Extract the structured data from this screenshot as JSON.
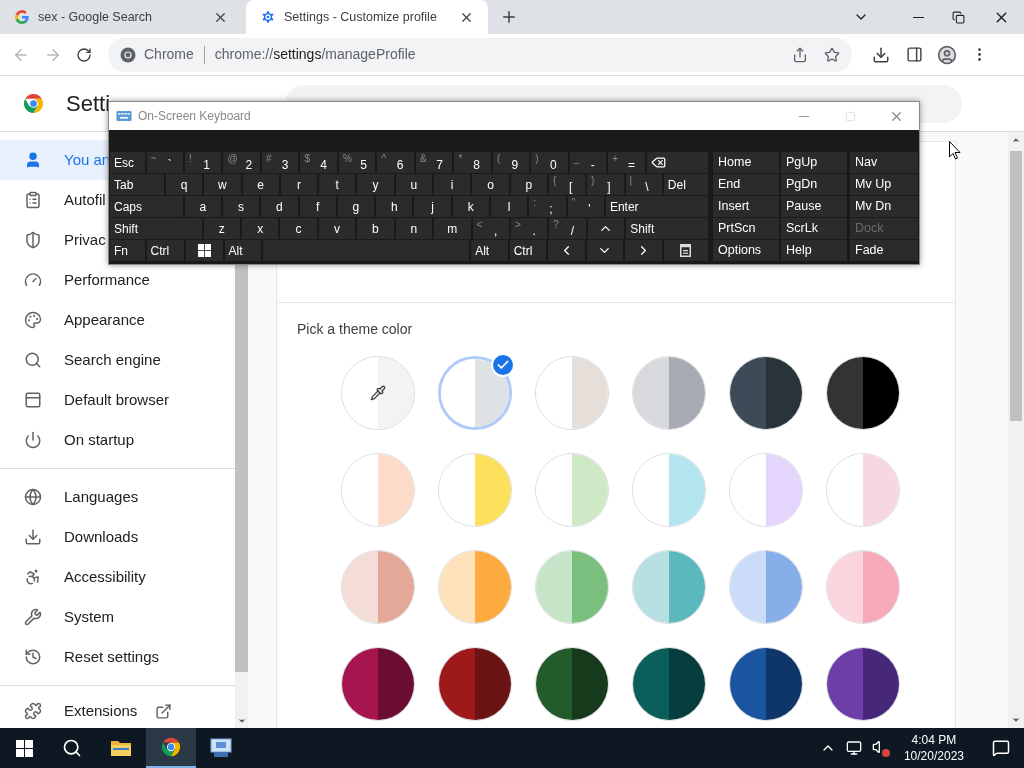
{
  "browser": {
    "tabs": [
      {
        "title": "sex - Google Search",
        "kind": "search",
        "selected": false
      },
      {
        "title": "Settings - Customize profile",
        "kind": "settings",
        "selected": true
      }
    ],
    "omnibox": {
      "chip": "Chrome",
      "url": {
        "scheme": "chrome://",
        "host": "settings",
        "path": "/manageProfile"
      }
    }
  },
  "settings": {
    "title": "Setti",
    "sidebar": {
      "groups": [
        [
          {
            "label": "You an",
            "selected": true
          },
          {
            "label": "Autofil",
            "selected": false
          },
          {
            "label": "Privac",
            "selected": false
          },
          {
            "label": "Performance",
            "selected": false
          },
          {
            "label": "Appearance",
            "selected": false
          },
          {
            "label": "Search engine",
            "selected": false
          },
          {
            "label": "Default browser",
            "selected": false
          },
          {
            "label": "On startup",
            "selected": false
          }
        ],
        [
          {
            "label": "Languages",
            "selected": false
          },
          {
            "label": "Downloads",
            "selected": false
          },
          {
            "label": "Accessibility",
            "selected": false
          },
          {
            "label": "System",
            "selected": false
          },
          {
            "label": "Reset settings",
            "selected": false
          }
        ],
        [
          {
            "label": "Extensions",
            "selected": false
          }
        ]
      ]
    }
  },
  "theme": {
    "heading": "Pick a theme color",
    "swatches": [
      {
        "kind": "custom",
        "halves": [
          {
            "color": "#ffffff"
          },
          {
            "color": "#f1f3f4"
          }
        ],
        "selected": false
      },
      {
        "kind": "preset",
        "halves": [
          {
            "color": "#ffffff"
          },
          {
            "color": "#dee1e6"
          }
        ],
        "selected": true
      },
      {
        "kind": "preset",
        "halves": [
          {
            "color": "#ffffff"
          },
          {
            "color": "#e6dfd9"
          }
        ],
        "selected": false
      },
      {
        "kind": "preset",
        "halves": [
          {
            "color": "#d7d9dd"
          },
          {
            "color": "#a8abb3"
          }
        ],
        "selected": false
      },
      {
        "kind": "preset",
        "halves": [
          {
            "color": "#3c4b57"
          },
          {
            "color": "#28333a"
          }
        ],
        "selected": false
      },
      {
        "kind": "preset",
        "halves": [
          {
            "color": "#333333"
          },
          {
            "color": "#000000"
          }
        ],
        "selected": false
      },
      {
        "kind": "preset",
        "halves": [
          {
            "color": "#ffffff"
          },
          {
            "color": "#fcdbc8"
          }
        ],
        "selected": false
      },
      {
        "kind": "preset",
        "halves": [
          {
            "color": "#ffffff"
          },
          {
            "color": "#fde05c"
          }
        ],
        "selected": false
      },
      {
        "kind": "preset",
        "halves": [
          {
            "color": "#ffffff"
          },
          {
            "color": "#cfe8c6"
          }
        ],
        "selected": false
      },
      {
        "kind": "preset",
        "halves": [
          {
            "color": "#ffffff"
          },
          {
            "color": "#b3e5ef"
          }
        ],
        "selected": false
      },
      {
        "kind": "preset",
        "halves": [
          {
            "color": "#ffffff"
          },
          {
            "color": "#e3d5fb"
          }
        ],
        "selected": false
      },
      {
        "kind": "preset",
        "halves": [
          {
            "color": "#ffffff"
          },
          {
            "color": "#f7d7e3"
          }
        ],
        "selected": false
      },
      {
        "kind": "preset",
        "halves": [
          {
            "color": "#f3ddd6"
          },
          {
            "color": "#e3a897"
          }
        ],
        "selected": false
      },
      {
        "kind": "preset",
        "halves": [
          {
            "color": "#fde2bb"
          },
          {
            "color": "#fdab41"
          }
        ],
        "selected": false
      },
      {
        "kind": "preset",
        "halves": [
          {
            "color": "#c6e5c8"
          },
          {
            "color": "#7abf7e"
          }
        ],
        "selected": false
      },
      {
        "kind": "preset",
        "halves": [
          {
            "color": "#b6e0e2"
          },
          {
            "color": "#5bb9be"
          }
        ],
        "selected": false
      },
      {
        "kind": "preset",
        "halves": [
          {
            "color": "#cbdcf8"
          },
          {
            "color": "#86aee9"
          }
        ],
        "selected": false
      },
      {
        "kind": "preset",
        "halves": [
          {
            "color": "#fad5dd"
          },
          {
            "color": "#f6a9b8"
          }
        ],
        "selected": false
      },
      {
        "kind": "preset",
        "halves": [
          {
            "color": "#a6154e"
          },
          {
            "color": "#6b0d32"
          }
        ],
        "selected": false
      },
      {
        "kind": "preset",
        "halves": [
          {
            "color": "#9e1a1a"
          },
          {
            "color": "#6a1414"
          }
        ],
        "selected": false
      },
      {
        "kind": "preset",
        "halves": [
          {
            "color": "#245b2a"
          },
          {
            "color": "#173a1c"
          }
        ],
        "selected": false
      },
      {
        "kind": "preset",
        "halves": [
          {
            "color": "#0a5e5c"
          },
          {
            "color": "#063e3d"
          }
        ],
        "selected": false
      },
      {
        "kind": "preset",
        "halves": [
          {
            "color": "#1a56a0"
          },
          {
            "color": "#0f3669"
          }
        ],
        "selected": false
      },
      {
        "kind": "preset",
        "halves": [
          {
            "color": "#6b3ea8"
          },
          {
            "color": "#46277a"
          }
        ],
        "selected": false
      }
    ]
  },
  "keyboard": {
    "title": "On-Screen Keyboard",
    "rows": [
      [
        {
          "kind": "word",
          "label": "Esc"
        },
        {
          "kind": "shifted",
          "shift": "~",
          "label": "`"
        },
        {
          "kind": "shifted",
          "shift": "!",
          "label": "1"
        },
        {
          "kind": "shifted",
          "shift": "@",
          "label": "2"
        },
        {
          "kind": "shifted",
          "shift": "#",
          "label": "3"
        },
        {
          "kind": "shifted",
          "shift": "$",
          "label": "4"
        },
        {
          "kind": "shifted",
          "shift": "%",
          "label": "5"
        },
        {
          "kind": "shifted",
          "shift": "^",
          "label": "6"
        },
        {
          "kind": "shifted",
          "shift": "&",
          "label": "7"
        },
        {
          "kind": "shifted",
          "shift": "*",
          "label": "8"
        },
        {
          "kind": "shifted",
          "shift": "(",
          "label": "9"
        },
        {
          "kind": "shifted",
          "shift": ")",
          "label": "0"
        },
        {
          "kind": "shifted",
          "shift": "_",
          "label": "-"
        },
        {
          "kind": "shifted",
          "shift": "+",
          "label": "="
        },
        {
          "kind": "backspace"
        }
      ],
      [
        {
          "kind": "word",
          "label": "Tab"
        },
        {
          "kind": "char",
          "label": "q"
        },
        {
          "kind": "char",
          "label": "w"
        },
        {
          "kind": "char",
          "label": "e"
        },
        {
          "kind": "char",
          "label": "r"
        },
        {
          "kind": "char",
          "label": "t"
        },
        {
          "kind": "char",
          "label": "y"
        },
        {
          "kind": "char",
          "label": "u"
        },
        {
          "kind": "char",
          "label": "i"
        },
        {
          "kind": "char",
          "label": "o"
        },
        {
          "kind": "char",
          "label": "p"
        },
        {
          "kind": "shifted",
          "shift": "{",
          "label": "["
        },
        {
          "kind": "shifted",
          "shift": "}",
          "label": "]"
        },
        {
          "kind": "shifted",
          "shift": "|",
          "label": "\\"
        },
        {
          "kind": "word",
          "label": "Del"
        }
      ],
      [
        {
          "kind": "word",
          "label": "Caps"
        },
        {
          "kind": "char",
          "label": "a"
        },
        {
          "kind": "char",
          "label": "s"
        },
        {
          "kind": "char",
          "label": "d"
        },
        {
          "kind": "char",
          "label": "f"
        },
        {
          "kind": "char",
          "label": "g"
        },
        {
          "kind": "char",
          "label": "h"
        },
        {
          "kind": "char",
          "label": "j"
        },
        {
          "kind": "char",
          "label": "k"
        },
        {
          "kind": "char",
          "label": "l"
        },
        {
          "kind": "shifted",
          "shift": ":",
          "label": ";"
        },
        {
          "kind": "shifted",
          "shift": "\"",
          "label": "'"
        },
        {
          "kind": "word",
          "label": "Enter"
        }
      ],
      [
        {
          "kind": "word",
          "label": "Shift"
        },
        {
          "kind": "char",
          "label": "z"
        },
        {
          "kind": "char",
          "label": "x"
        },
        {
          "kind": "char",
          "label": "c"
        },
        {
          "kind": "char",
          "label": "v"
        },
        {
          "kind": "char",
          "label": "b"
        },
        {
          "kind": "char",
          "label": "n"
        },
        {
          "kind": "char",
          "label": "m"
        },
        {
          "kind": "shifted",
          "shift": "<",
          "label": ","
        },
        {
          "kind": "shifted",
          "shift": ">",
          "label": "."
        },
        {
          "kind": "shifted",
          "shift": "?",
          "label": "/"
        },
        {
          "kind": "up"
        },
        {
          "kind": "word",
          "label": "Shift"
        }
      ],
      [
        {
          "kind": "word",
          "label": "Fn"
        },
        {
          "kind": "word",
          "label": "Ctrl"
        },
        {
          "kind": "windows"
        },
        {
          "kind": "word",
          "label": "Alt"
        },
        {
          "kind": "space"
        },
        {
          "kind": "word",
          "label": "Alt"
        },
        {
          "kind": "word",
          "label": "Ctrl"
        },
        {
          "kind": "left"
        },
        {
          "kind": "down"
        },
        {
          "kind": "right"
        },
        {
          "kind": "menu"
        }
      ]
    ],
    "nav": [
      [
        {
          "label": "Home",
          "disabled": false
        },
        {
          "label": "PgUp",
          "disabled": false
        },
        {
          "label": "Nav",
          "disabled": false
        }
      ],
      [
        {
          "label": "End",
          "disabled": false
        },
        {
          "label": "PgDn",
          "disabled": false
        },
        {
          "label": "Mv Up",
          "disabled": false
        }
      ],
      [
        {
          "label": "Insert",
          "disabled": false
        },
        {
          "label": "Pause",
          "disabled": false
        },
        {
          "label": "Mv Dn",
          "disabled": false
        }
      ],
      [
        {
          "label": "PrtScn",
          "disabled": false
        },
        {
          "label": "ScrLk",
          "disabled": false
        },
        {
          "label": "Dock",
          "disabled": true
        }
      ],
      [
        {
          "label": "Options",
          "disabled": false
        },
        {
          "label": "Help",
          "disabled": false
        },
        {
          "label": "Fade",
          "disabled": false
        }
      ]
    ]
  },
  "taskbar": {
    "apps": [
      {
        "kind": "explorer",
        "active": false
      },
      {
        "kind": "chrome",
        "active": true
      },
      {
        "kind": "keyboard",
        "active": false
      }
    ],
    "volume_muted": true,
    "time": "4:04 PM",
    "date": "10/20/2023"
  }
}
